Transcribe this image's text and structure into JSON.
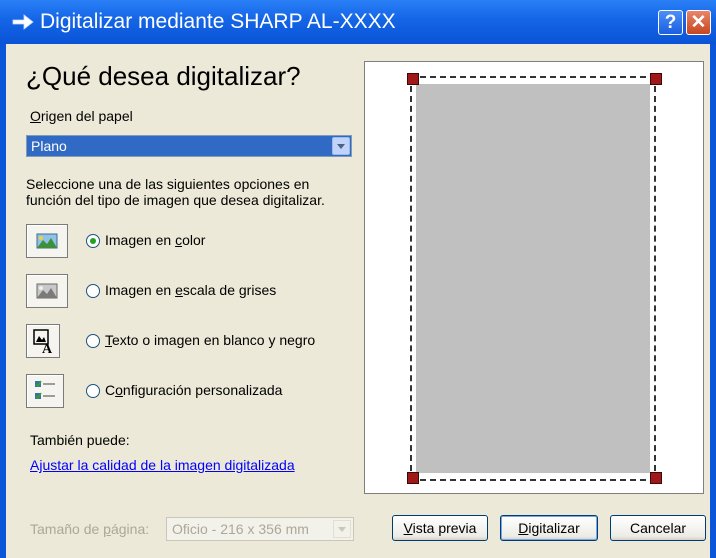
{
  "window": {
    "title": "Digitalizar mediante SHARP AL-XXXX",
    "help_glyph": "?",
    "close_glyph": "✕"
  },
  "heading": "¿Qué desea digitalizar?",
  "paper_source": {
    "label_first": "O",
    "label_rest": "rigen del papel",
    "value": "Plano"
  },
  "description": "Seleccione una de las siguientes opciones en función del tipo de imagen que desea digitalizar.",
  "options": [
    {
      "pre": "Imagen en ",
      "key": "c",
      "post": "olor",
      "icon": "color-photo-icon",
      "selected": true
    },
    {
      "pre": "Imagen en ",
      "key": "e",
      "post": "scala de grises",
      "icon": "grayscale-photo-icon",
      "selected": false
    },
    {
      "pre": "",
      "key": "T",
      "post": "exto o imagen en blanco y negro",
      "icon": "text-image-icon",
      "selected": false
    },
    {
      "pre": "C",
      "key": "o",
      "post": "nfiguración personalizada",
      "icon": "custom-settings-icon",
      "selected": false
    }
  ],
  "also": {
    "label": "También puede:",
    "link": "Ajustar la calidad de la imagen digitalizada"
  },
  "page_size": {
    "label_pre": "Tamaño de ",
    "label_key": "p",
    "label_post": "ágina:",
    "value": "Oficio - 216 x 356 mm"
  },
  "buttons": {
    "preview_key": "V",
    "preview_rest": "ista previa",
    "scan_key": "D",
    "scan_rest": "igitalizar",
    "cancel": "Cancelar"
  },
  "colors": {
    "title_bar": "#0a53d6",
    "client_bg": "#ece9d8",
    "selection": "#316ac5",
    "handle": "#a01818",
    "link": "#0000ff"
  }
}
